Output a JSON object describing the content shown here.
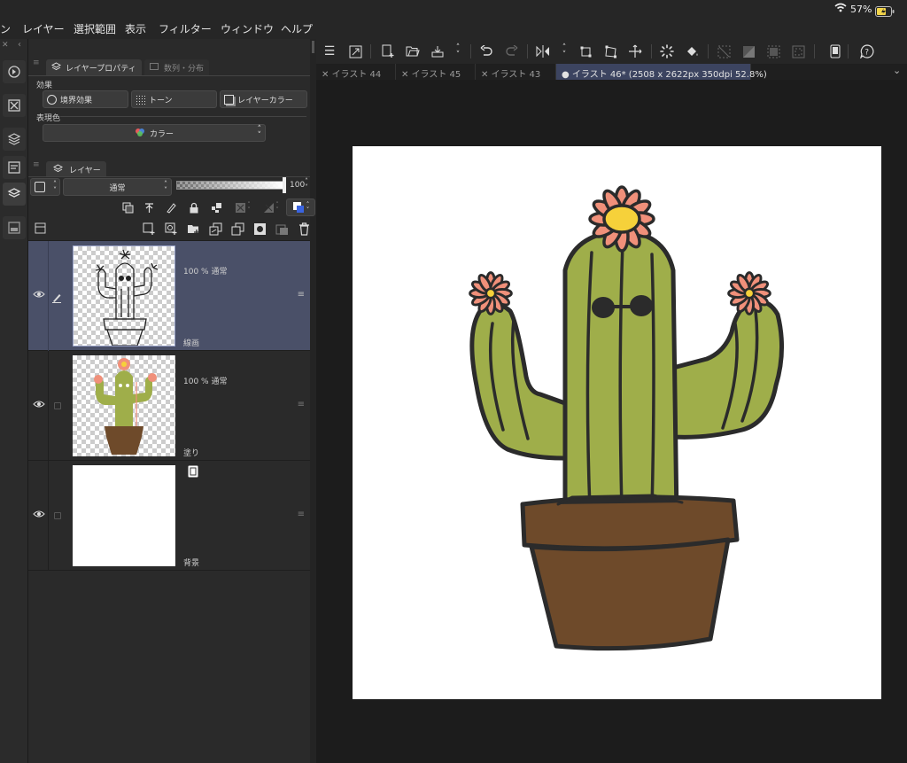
{
  "status": {
    "battery_percent": "57%"
  },
  "menu": {
    "items": [
      "ン",
      "レイヤー",
      "選択範囲",
      "表示",
      "フィルター",
      "ウィンドウ",
      "ヘルプ"
    ]
  },
  "properties_panel": {
    "tab_active": "レイヤープロパティ",
    "tab_inactive": "数列・分布",
    "effect_label": "効果",
    "effect_buttons": [
      "境界効果",
      "トーン",
      "レイヤーカラー"
    ],
    "expression_label": "表現色",
    "expression_value": "カラー"
  },
  "layer_panel": {
    "tab": "レイヤー",
    "blend_mode": "通常",
    "opacity": "100"
  },
  "layers": [
    {
      "meta": "100 %  通常",
      "name": "線画",
      "selected": true
    },
    {
      "meta": "100 %  通常",
      "name": "塗り",
      "selected": false
    },
    {
      "meta": "",
      "name": "背景",
      "selected": false
    }
  ],
  "doc_tabs": [
    {
      "label": "イラスト 44",
      "active": false
    },
    {
      "label": "イラスト 45",
      "active": false
    },
    {
      "label": "イラスト 43",
      "active": false
    },
    {
      "label": "イラスト 46* (2508 x 2622px 350dpi 52.8%)",
      "active": true
    }
  ],
  "colors": {
    "cactus": "#9fae4a",
    "pot": "#6e4a2a",
    "flower": "#f0907a",
    "flower_center": "#f6d13a",
    "outline": "#2b2b2b",
    "selection": "#4a5068"
  }
}
